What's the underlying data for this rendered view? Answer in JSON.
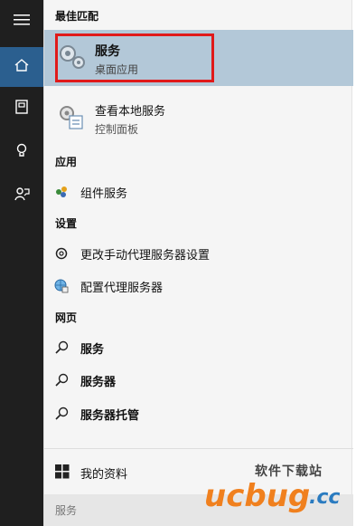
{
  "left_rail": {
    "items": [
      "menu-icon",
      "home-icon",
      "notebook-icon",
      "lightbulb-icon",
      "feedback-icon"
    ]
  },
  "search_results": {
    "best_match_header": "最佳匹配",
    "best_match": {
      "title": "服务",
      "subtitle": "桌面应用"
    },
    "secondary_match": {
      "title": "查看本地服务",
      "subtitle": "控制面板"
    },
    "apps_header": "应用",
    "apps": [
      {
        "label": "组件服务"
      }
    ],
    "settings_header": "设置",
    "settings": [
      {
        "label": "更改手动代理服务器设置"
      },
      {
        "label": "配置代理服务器"
      }
    ],
    "web_header": "网页",
    "web": [
      {
        "label": "服务"
      },
      {
        "label": "服务器"
      },
      {
        "label": "服务器托管"
      }
    ]
  },
  "bottom": {
    "my_stuff": "我的资料",
    "search_query": "服务"
  },
  "watermark": {
    "top": "软件下载站",
    "main": "ucbug",
    "suffix": ".cc"
  },
  "colors": {
    "rail": "#1f1f1f",
    "rail_active": "#2b5f8f",
    "best_match_bg": "#b3c8d8",
    "highlight": "#e01a1a",
    "watermark_orange": "#f0801e",
    "watermark_blue": "#2a7bc0"
  }
}
